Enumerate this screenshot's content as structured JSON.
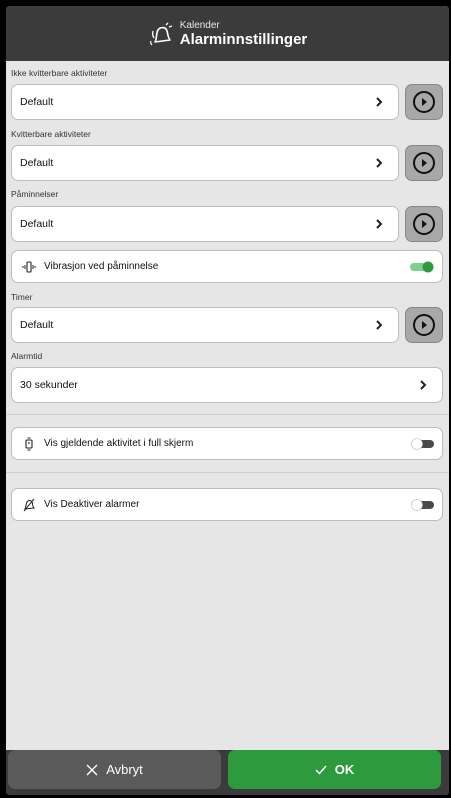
{
  "header": {
    "subtitle": "Kalender",
    "title": "Alarminnstillinger"
  },
  "sections": {
    "ikke_kvitterbare": {
      "label": "Ikke kvitterbare aktiviteter",
      "value": "Default"
    },
    "kvitterbare": {
      "label": "Kvitterbare aktiviteter",
      "value": "Default"
    },
    "paminnelser": {
      "label": "Påminnelser",
      "value": "Default"
    },
    "vibrasjon": {
      "label": "Vibrasjon ved påminnelse",
      "enabled": true
    },
    "timer": {
      "label": "Timer",
      "value": "Default"
    },
    "alarmtid": {
      "label": "Alarmtid",
      "value": "30 sekunder"
    },
    "fullskjerm": {
      "label": "Vis gjeldende aktivitet i full skjerm",
      "enabled": false
    },
    "deaktiver": {
      "label": "Vis Deaktiver alarmer",
      "enabled": false
    }
  },
  "footer": {
    "cancel_label": "Avbryt",
    "ok_label": "OK"
  },
  "colors": {
    "accent_green": "#2e9a3e",
    "header_bg": "#3b3b3b"
  }
}
